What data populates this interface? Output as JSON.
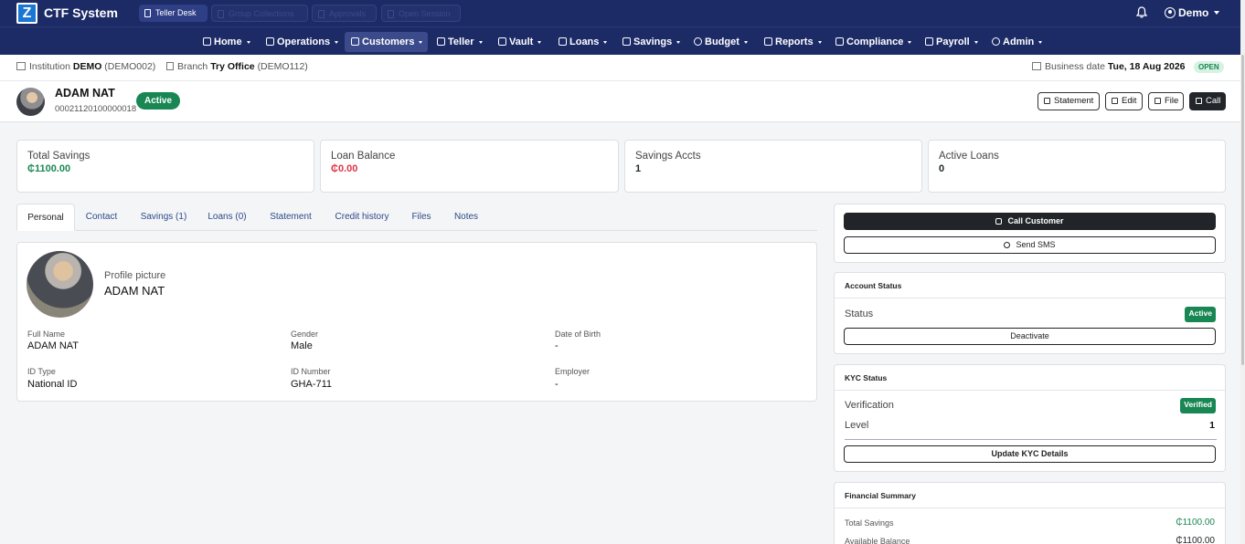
{
  "app": {
    "logo_letter": "Z",
    "title": "CTF System",
    "top_pills": [
      {
        "label": "Teller Desk",
        "enabled": true
      },
      {
        "label": "Group Collections",
        "enabled": false
      },
      {
        "label": "Approvals",
        "enabled": false
      },
      {
        "label": "Open Session",
        "enabled": false
      }
    ],
    "user": "Demo"
  },
  "nav": [
    {
      "label": "Home",
      "icon": "home-icon"
    },
    {
      "label": "Operations",
      "icon": "calendar-icon"
    },
    {
      "label": "Customers",
      "icon": "users-icon",
      "active": true
    },
    {
      "label": "Teller",
      "icon": "bank-icon"
    },
    {
      "label": "Vault",
      "icon": "safe-icon"
    },
    {
      "label": "Loans",
      "icon": "bank-icon"
    },
    {
      "label": "Savings",
      "icon": "piggy-bank-icon"
    },
    {
      "label": "Budget",
      "icon": "pie-chart-icon"
    },
    {
      "label": "Reports",
      "icon": "graph-icon"
    },
    {
      "label": "Compliance",
      "icon": "shield-icon"
    },
    {
      "label": "Payroll",
      "icon": "wallet-icon"
    },
    {
      "label": "Admin",
      "icon": "gear-icon"
    }
  ],
  "context": {
    "institution_label": "Institution",
    "institution_name": "DEMO",
    "institution_code": "(DEMO002)",
    "branch_label": "Branch",
    "branch_name": "Try Office",
    "branch_code": "(DEMO112)",
    "business_date_label": "Business date",
    "business_date": "Tue, 18 Aug 2026",
    "status": "OPEN"
  },
  "customer": {
    "name": "ADAM NAT",
    "account_number": "00021120100000018",
    "status": "Active",
    "actions": [
      "Statement",
      "Edit",
      "File",
      "Call"
    ]
  },
  "stats": [
    {
      "label": "Total Savings",
      "value": "₵1100.00",
      "color": "#198754"
    },
    {
      "label": "Loan Balance",
      "value": "₵0.00",
      "color": "#dc3545"
    },
    {
      "label": "Savings Accts",
      "value": "1",
      "color": "#111111"
    },
    {
      "label": "Active Loans",
      "value": "0",
      "color": "#111111"
    }
  ],
  "tabs": [
    "Personal",
    "Contact",
    "Savings (1)",
    "Loans (0)",
    "Statement",
    "Credit history",
    "Files",
    "Notes"
  ],
  "profile": {
    "picture_label": "Profile picture",
    "name": "ADAM NAT",
    "fields": [
      {
        "label": "Full Name",
        "value": "ADAM NAT"
      },
      {
        "label": "Gender",
        "value": "Male"
      },
      {
        "label": "Date of Birth",
        "value": "-"
      },
      {
        "label": "ID Type",
        "value": "National ID"
      },
      {
        "label": "ID Number",
        "value": "GHA-711"
      },
      {
        "label": "Employer",
        "value": "-"
      }
    ]
  },
  "side": {
    "call_label": "Call Customer",
    "sms_label": "Send SMS",
    "account_status": {
      "title": "Account Status",
      "status_label": "Status",
      "status_value": "Active",
      "deactivate_label": "Deactivate"
    },
    "kyc": {
      "title": "KYC Status",
      "verification_label": "Verification",
      "verification_value": "Verified",
      "level_label": "Level",
      "level_value": "1",
      "update_label": "Update KYC Details"
    },
    "financial": {
      "title": "Financial Summary",
      "rows": [
        {
          "label": "Total Savings",
          "value": "₵1100.00",
          "color": "#198754"
        },
        {
          "label": "Available Balance",
          "value": "₵1100.00",
          "color": "#111111"
        }
      ]
    }
  }
}
